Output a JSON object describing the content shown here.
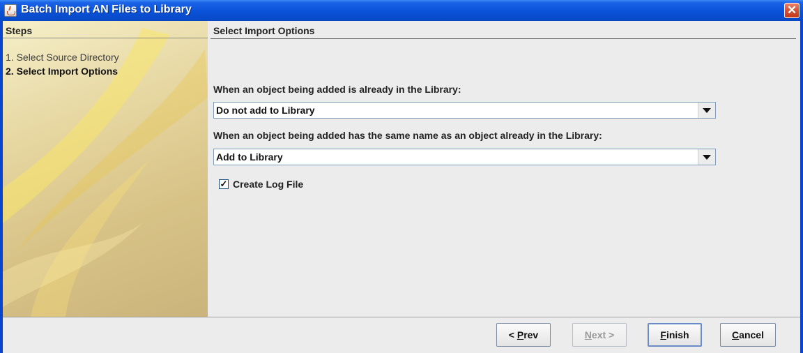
{
  "window": {
    "title": "Batch Import AN Files to Library"
  },
  "steps": {
    "title": "Steps",
    "items": [
      {
        "label": "1. Select Source Directory",
        "active": false
      },
      {
        "label": "2. Select Import Options",
        "active": true
      }
    ]
  },
  "main": {
    "title": "Select Import Options",
    "existing_label": "When an object being added is already in the Library:",
    "existing_value": "Do not add to Library",
    "same_name_label": "When an object being added has the same name as an object already in the Library:",
    "same_name_value": "Add to Library",
    "log_label": "Create Log File",
    "log_checked": true
  },
  "buttons": {
    "prev": {
      "prefix": "< ",
      "mnemonic": "P",
      "rest": "rev"
    },
    "next": {
      "mnemonic": "N",
      "rest": "ext >"
    },
    "finish": {
      "mnemonic": "F",
      "rest": "inish"
    },
    "cancel": {
      "mnemonic": "C",
      "rest": "ancel"
    }
  },
  "colors": {
    "titlebar": "#0a52d8",
    "steps_panel": "#d8c387",
    "close_button": "#d65033"
  }
}
